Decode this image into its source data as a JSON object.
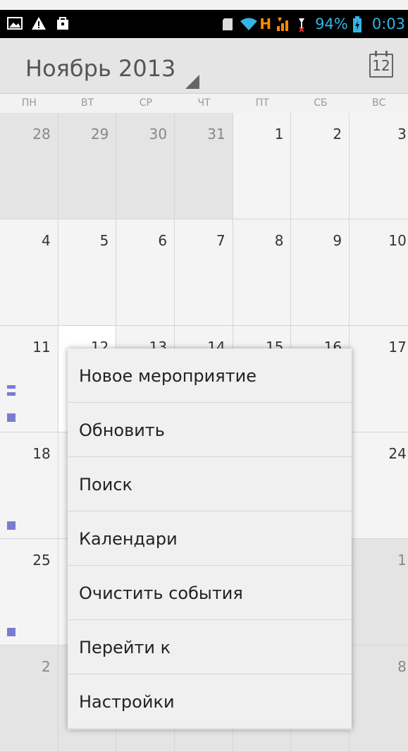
{
  "statusbar": {
    "network": "H",
    "battery": "94%",
    "time": "0:03"
  },
  "header": {
    "title": "Ноябрь 2013",
    "today_day": "12"
  },
  "weekdays": [
    "ПН",
    "ВТ",
    "СР",
    "ЧТ",
    "ПТ",
    "СБ",
    "ВС"
  ],
  "weeks": [
    [
      "28",
      "29",
      "30",
      "31",
      "1",
      "2",
      "3"
    ],
    [
      "4",
      "5",
      "6",
      "7",
      "8",
      "9",
      "10"
    ],
    [
      "11",
      "12",
      "13",
      "14",
      "15",
      "16",
      "17"
    ],
    [
      "18",
      "",
      "",
      "",
      "",
      "",
      "24"
    ],
    [
      "25",
      "",
      "",
      "",
      "",
      "",
      "1"
    ],
    [
      "2",
      "",
      "",
      "",
      "",
      "",
      "8"
    ]
  ],
  "menu": {
    "items": [
      "Новое мероприятие",
      "Обновить",
      "Поиск",
      "Календари",
      "Очистить события",
      "Перейти к",
      "Настройки"
    ]
  },
  "colors": {
    "accent": "#33b5e5",
    "event": "#7b7bd4",
    "signal": "#ff8a00"
  }
}
